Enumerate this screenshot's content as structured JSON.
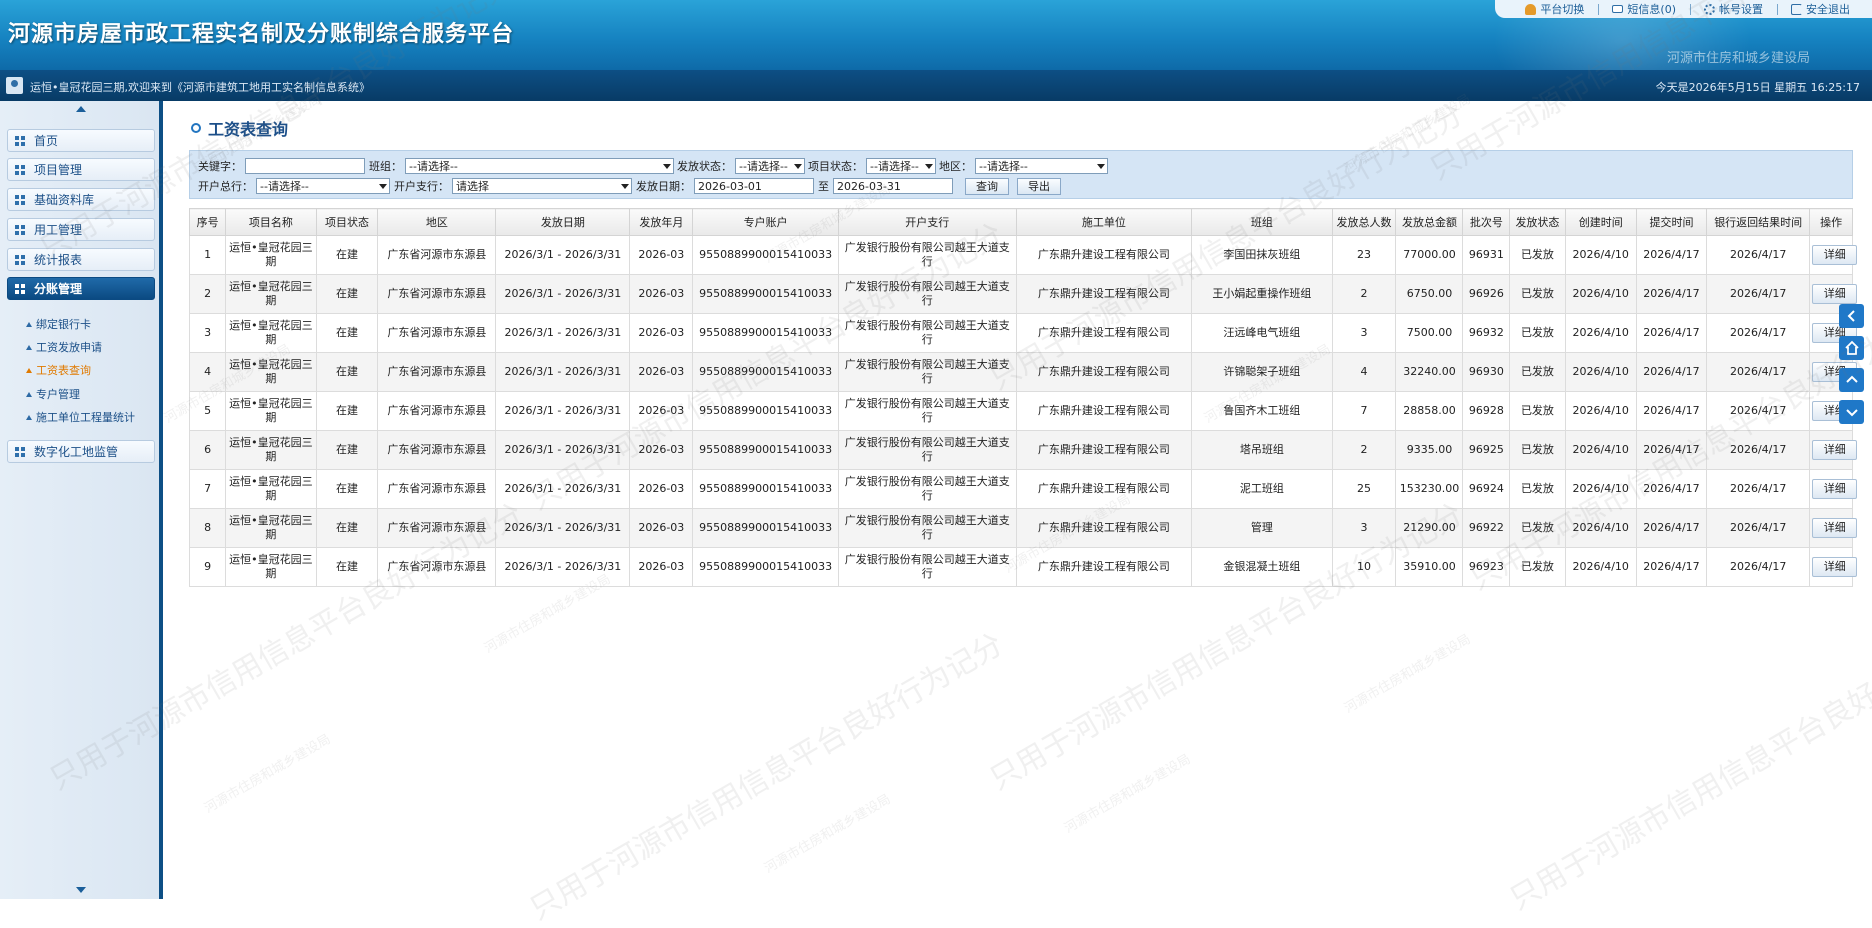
{
  "header": {
    "title": "河源市房屋市政工程实名制及分账制综合服务平台",
    "org": "河源市住房和城乡建设局",
    "links": [
      {
        "label": "平台切换",
        "icon": "user-switch-icon"
      },
      {
        "label": "短信息(0)",
        "icon": "mail-icon"
      },
      {
        "label": "帐号设置",
        "icon": "gear-icon"
      },
      {
        "label": "安全退出",
        "icon": "logout-icon"
      }
    ]
  },
  "subbar": {
    "welcome": "运恒•皇冠花园三期,欢迎来到《河源市建筑工地用工实名制信息系统》",
    "today": "今天是2026年5月15日 星期五 16:25:17"
  },
  "sidebar": {
    "items": [
      {
        "label": "首页"
      },
      {
        "label": "项目管理"
      },
      {
        "label": "基础资料库"
      },
      {
        "label": "用工管理"
      },
      {
        "label": "统计报表"
      },
      {
        "label": "分账管理"
      },
      {
        "label": "数字化工地监管"
      }
    ],
    "sub_items": [
      {
        "label": "绑定银行卡"
      },
      {
        "label": "工资发放申请"
      },
      {
        "label": "工资表查询"
      },
      {
        "label": "专户管理"
      },
      {
        "label": "施工单位工程量统计"
      }
    ]
  },
  "page": {
    "title": "工资表查询"
  },
  "filters": {
    "keyword_label": "关键字：",
    "keyword_value": "",
    "team_label": "班组：",
    "team_value": "--请选择--",
    "pay_status_label": "发放状态：",
    "pay_status_value": "--请选择--",
    "project_status_label": "项目状态：",
    "project_status_value": "--请选择--",
    "region_label": "地区：",
    "region_value": "--请选择--",
    "head_bank_label": "开户总行：",
    "head_bank_value": "--请选择--",
    "branch_label": "开户支行：",
    "branch_value": "请选择",
    "date_label": "发放日期：",
    "date_from": "2026-03-01",
    "date_to_label": "至",
    "date_to": "2026-03-31",
    "query_button": "查询",
    "export_button": "导出"
  },
  "table": {
    "headers": [
      "序号",
      "项目名称",
      "项目状态",
      "地区",
      "发放日期",
      "发放年月",
      "专户账户",
      "开户支行",
      "施工单位",
      "班组",
      "发放总人数",
      "发放总金额",
      "批次号",
      "发放状态",
      "创建时间",
      "提交时间",
      "银行返回结果时间",
      "操作"
    ],
    "detail_label": "详细",
    "rows": [
      [
        "1",
        "运恒•皇冠花园三期",
        "在建",
        "广东省河源市东源县",
        "2026/3/1 - 2026/3/31",
        "2026-03",
        "9550889900015410033",
        "广发银行股份有限公司越王大道支行",
        "广东鼎升建设工程有限公司",
        "李国田抹灰班组",
        "23",
        "77000.00",
        "96931",
        "已发放",
        "2026/4/10",
        "2026/4/17",
        "2026/4/17"
      ],
      [
        "2",
        "运恒•皇冠花园三期",
        "在建",
        "广东省河源市东源县",
        "2026/3/1 - 2026/3/31",
        "2026-03",
        "9550889900015410033",
        "广发银行股份有限公司越王大道支行",
        "广东鼎升建设工程有限公司",
        "王小娟起重操作班组",
        "2",
        "6750.00",
        "96926",
        "已发放",
        "2026/4/10",
        "2026/4/17",
        "2026/4/17"
      ],
      [
        "3",
        "运恒•皇冠花园三期",
        "在建",
        "广东省河源市东源县",
        "2026/3/1 - 2026/3/31",
        "2026-03",
        "9550889900015410033",
        "广发银行股份有限公司越王大道支行",
        "广东鼎升建设工程有限公司",
        "汪远峰电气班组",
        "3",
        "7500.00",
        "96932",
        "已发放",
        "2026/4/10",
        "2026/4/17",
        "2026/4/17"
      ],
      [
        "4",
        "运恒•皇冠花园三期",
        "在建",
        "广东省河源市东源县",
        "2026/3/1 - 2026/3/31",
        "2026-03",
        "9550889900015410033",
        "广发银行股份有限公司越王大道支行",
        "广东鼎升建设工程有限公司",
        "许锦聪架子班组",
        "4",
        "32240.00",
        "96930",
        "已发放",
        "2026/4/10",
        "2026/4/17",
        "2026/4/17"
      ],
      [
        "5",
        "运恒•皇冠花园三期",
        "在建",
        "广东省河源市东源县",
        "2026/3/1 - 2026/3/31",
        "2026-03",
        "9550889900015410033",
        "广发银行股份有限公司越王大道支行",
        "广东鼎升建设工程有限公司",
        "鲁国齐木工班组",
        "7",
        "28858.00",
        "96928",
        "已发放",
        "2026/4/10",
        "2026/4/17",
        "2026/4/17"
      ],
      [
        "6",
        "运恒•皇冠花园三期",
        "在建",
        "广东省河源市东源县",
        "2026/3/1 - 2026/3/31",
        "2026-03",
        "9550889900015410033",
        "广发银行股份有限公司越王大道支行",
        "广东鼎升建设工程有限公司",
        "塔吊班组",
        "2",
        "9335.00",
        "96925",
        "已发放",
        "2026/4/10",
        "2026/4/17",
        "2026/4/17"
      ],
      [
        "7",
        "运恒•皇冠花园三期",
        "在建",
        "广东省河源市东源县",
        "2026/3/1 - 2026/3/31",
        "2026-03",
        "9550889900015410033",
        "广发银行股份有限公司越王大道支行",
        "广东鼎升建设工程有限公司",
        "泥工班组",
        "25",
        "153230.00",
        "96924",
        "已发放",
        "2026/4/10",
        "2026/4/17",
        "2026/4/17"
      ],
      [
        "8",
        "运恒•皇冠花园三期",
        "在建",
        "广东省河源市东源县",
        "2026/3/1 - 2026/3/31",
        "2026-03",
        "9550889900015410033",
        "广发银行股份有限公司越王大道支行",
        "广东鼎升建设工程有限公司",
        "管理",
        "3",
        "21290.00",
        "96922",
        "已发放",
        "2026/4/10",
        "2026/4/17",
        "2026/4/17"
      ],
      [
        "9",
        "运恒•皇冠花园三期",
        "在建",
        "广东省河源市东源县",
        "2026/3/1 - 2026/3/31",
        "2026-03",
        "9550889900015410033",
        "广发银行股份有限公司越王大道支行",
        "广东鼎升建设工程有限公司",
        "金银混凝土班组",
        "10",
        "35910.00",
        "96923",
        "已发放",
        "2026/4/10",
        "2026/4/17",
        "2026/4/17"
      ]
    ]
  },
  "watermark": {
    "line1": "只用于河源市信用信息平台良好行为记分",
    "line2": "河源市住房和城乡建设局"
  },
  "colors": {
    "header_blue": "#1683c1",
    "nav_dark": "#0b4a82",
    "active_sub": "#e07a00",
    "float_blue": "#1f78c8"
  }
}
